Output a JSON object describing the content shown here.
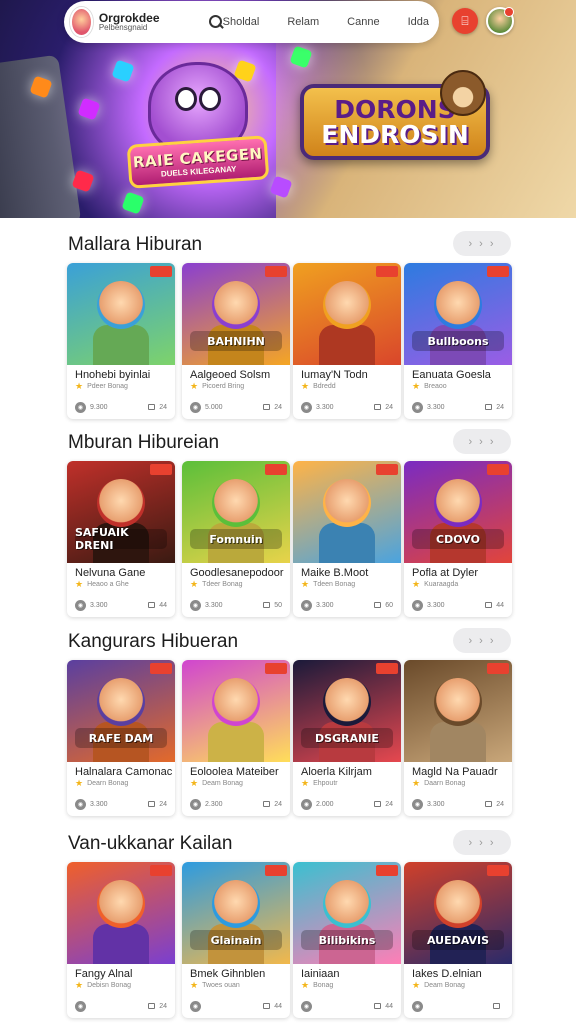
{
  "nav": {
    "brand_title": "Orgrokdee",
    "brand_subtitle": "Pelbensgnaid",
    "links": [
      "Sholdal",
      "Relam",
      "Canne",
      "Idda"
    ],
    "notif_glyph": "⌸",
    "icons": {
      "search": "search-icon",
      "notifications": "notification-icon",
      "avatar": "user-avatar"
    }
  },
  "hero": {
    "left_title": "RAIE CAKEGEN",
    "left_subtitle": "DUELS KILEGANAY",
    "right_line1": "DORONS",
    "right_line2": "ENDROSIN"
  },
  "more_label": "› › ›",
  "sections": [
    {
      "title": "Mallara Hiburan",
      "cards": [
        {
          "title": "Hnohebi byinlai",
          "sub": "Pdeer Bonag",
          "count": "9.300",
          "meta": "24",
          "cap": ""
        },
        {
          "title": "Aalgeoed Solsm",
          "sub": "Picoerd Bring",
          "count": "5.000",
          "meta": "24",
          "cap": "BAHNIHN"
        },
        {
          "title": "Iumay'N Todn",
          "sub": "Bdredd",
          "count": "3.300",
          "meta": "24",
          "cap": ""
        },
        {
          "title": "Eanuata Goesla",
          "sub": "Breaoo",
          "count": "3.300",
          "meta": "24",
          "cap": "Bullboons"
        }
      ]
    },
    {
      "title": "Mburan Hibureian",
      "cards": [
        {
          "title": "Nelvuna Gane",
          "sub": "Heaoo a Ghe",
          "count": "3.300",
          "meta": "44",
          "cap": "SAFUAIK DRENI"
        },
        {
          "title": "Goodlesanepodoor",
          "sub": "Tdeer Bonag",
          "count": "3.300",
          "meta": "50",
          "cap": "Fomnuin"
        },
        {
          "title": "Maike B.Moot",
          "sub": "Tdeen Bonag",
          "count": "3.300",
          "meta": "60",
          "cap": ""
        },
        {
          "title": "Pofla at Dyler",
          "sub": "Kuaraagda",
          "count": "3.300",
          "meta": "44",
          "cap": "CDOVO"
        }
      ]
    },
    {
      "title": "Kangurars Hibueran",
      "cards": [
        {
          "title": "Halnalara Camonac",
          "sub": "Dearn Bonag",
          "count": "3.300",
          "meta": "24",
          "cap": "RAFE DAM"
        },
        {
          "title": "Eoloolea Mateiber",
          "sub": "Deam Bonag",
          "count": "2.300",
          "meta": "24",
          "cap": ""
        },
        {
          "title": "Aloerla Kilrjam",
          "sub": "Ehpoutr",
          "count": "2.000",
          "meta": "24",
          "cap": "DSGRANIE"
        },
        {
          "title": "Magld Na Pauadr",
          "sub": "Daarn Bonag",
          "count": "3.300",
          "meta": "24",
          "cap": ""
        }
      ]
    },
    {
      "title": "Van-ukkanar Kailan",
      "cards": [
        {
          "title": "Fangy Alnal",
          "sub": "Debisn Bonag",
          "count": "",
          "meta": "24",
          "cap": ""
        },
        {
          "title": "Bmek Gihnblen",
          "sub": "Twoes ouan",
          "count": "",
          "meta": "44",
          "cap": "Glainain"
        },
        {
          "title": "Iainiaan",
          "sub": "Bonag",
          "count": "",
          "meta": "44",
          "cap": "Bilibikins"
        },
        {
          "title": "Iakes D.elnian",
          "sub": "Deam Bonag",
          "count": "",
          "meta": "",
          "cap": "AUEDAVIS"
        }
      ]
    }
  ],
  "colors": {
    "accent": "#e8412f",
    "star": "#f3b51a",
    "card_bgs": [
      [
        "#3aa0d8",
        "#7ed36a"
      ],
      [
        "#8a3fd0",
        "#f5a623"
      ],
      [
        "#f0a020",
        "#d9462b"
      ],
      [
        "#2d7be0",
        "#9b5de5"
      ],
      [
        "#c0302a",
        "#3a1a12"
      ],
      [
        "#5bbf3a",
        "#e8d34a"
      ],
      [
        "#ffb347",
        "#4aa3df"
      ],
      [
        "#7a2bc2",
        "#e2453a"
      ],
      [
        "#5a3fa0",
        "#e36a2a"
      ],
      [
        "#d045d0",
        "#ffde59"
      ],
      [
        "#1a1a3a",
        "#e6484f"
      ],
      [
        "#6a4a2a",
        "#c9a77a"
      ],
      [
        "#f0602a",
        "#7a3fd0"
      ],
      [
        "#2d9be0",
        "#f2b84b"
      ],
      [
        "#3ac0d0",
        "#ff7eb6"
      ],
      [
        "#d0402a",
        "#2a2a6a"
      ]
    ]
  }
}
